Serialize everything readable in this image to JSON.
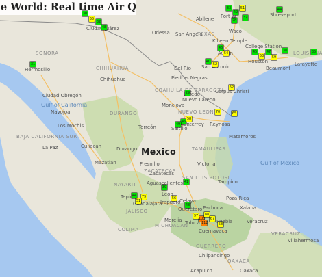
{
  "title": "e World: Real time Air Quality map",
  "country_label": "Mexico",
  "water_labels": [
    "Gulf of California",
    "Gulf of Mexico"
  ],
  "regions": [
    {
      "id": "sonora",
      "text": "SONORA"
    },
    {
      "id": "chihuahua",
      "text": "CHIHUAHUA"
    },
    {
      "id": "coahuila",
      "text": "COAHUILA DE ZARAGOZA"
    },
    {
      "id": "texas",
      "text": "TEXAS"
    },
    {
      "id": "nuevo-leon",
      "text": "NUEVO LEON"
    },
    {
      "id": "tamaulipas",
      "text": "TAMAULIPAS"
    },
    {
      "id": "durango",
      "text": "DURANGO"
    },
    {
      "id": "zacatecas",
      "text": "ZACATECAS"
    },
    {
      "id": "san-luis",
      "text": "SAN LUIS POTOSI"
    },
    {
      "id": "nayarit",
      "text": "NAYARIT"
    },
    {
      "id": "jalisco",
      "text": "JALISCO"
    },
    {
      "id": "michoacan",
      "text": "MICHOACAN"
    },
    {
      "id": "guerrero",
      "text": "GUERRERO"
    },
    {
      "id": "oaxaca",
      "text": "OAXACA"
    },
    {
      "id": "veracruz",
      "text": "VERACRUZ"
    },
    {
      "id": "baja",
      "text": "BAJA CALIFORNIA SUR"
    },
    {
      "id": "louisiana",
      "text": "LOUISIANA"
    },
    {
      "id": "colima",
      "text": "COLIMA"
    }
  ],
  "cities": [
    {
      "id": "ciudad-juarez",
      "text": "Ciudad Juárez"
    },
    {
      "id": "hermosillo",
      "text": "Hermosillo"
    },
    {
      "id": "chihuahua-city",
      "text": "Chihuahua"
    },
    {
      "id": "monterrey",
      "text": "Monterrey"
    },
    {
      "id": "saltillo",
      "text": "Saltillo"
    },
    {
      "id": "torreon",
      "text": "Torreón"
    },
    {
      "id": "durango-city",
      "text": "Durango"
    },
    {
      "id": "culiacan",
      "text": "Culiacán"
    },
    {
      "id": "mazatlan",
      "text": "Mazatlán"
    },
    {
      "id": "la-paz",
      "text": "La Paz"
    },
    {
      "id": "los-mochis",
      "text": "Los Mochis"
    },
    {
      "id": "aguascalientes",
      "text": "Aguascalientes"
    },
    {
      "id": "guadalajara",
      "text": "Guadalajara"
    },
    {
      "id": "tepic",
      "text": "Tepic"
    },
    {
      "id": "leon",
      "text": "León"
    },
    {
      "id": "queretaro",
      "text": "Querétaro"
    },
    {
      "id": "morelia",
      "text": "Morelia"
    },
    {
      "id": "puebla",
      "text": "Puebla"
    },
    {
      "id": "toluca",
      "text": "Toluca"
    },
    {
      "id": "acapulco",
      "text": "Acapulco"
    },
    {
      "id": "veracruz-city",
      "text": "Veracruz"
    },
    {
      "id": "tampico",
      "text": "Tampico"
    },
    {
      "id": "victoria",
      "text": "Victoria"
    },
    {
      "id": "matamoros",
      "text": "Matamoros"
    },
    {
      "id": "reynosa",
      "text": "Reynosa"
    },
    {
      "id": "nuevo-laredo",
      "text": "Nuevo Laredo"
    },
    {
      "id": "laredo",
      "text": "Laredo"
    },
    {
      "id": "corpus",
      "text": "Corpus Christi"
    },
    {
      "id": "san-antonio",
      "text": "San Antonio"
    },
    {
      "id": "austin",
      "text": "Austin"
    },
    {
      "id": "houston",
      "text": "Houston"
    },
    {
      "id": "san-angelo",
      "text": "San Angelo"
    },
    {
      "id": "odessa",
      "text": "Odessa"
    },
    {
      "id": "abilene",
      "text": "Abilene"
    },
    {
      "id": "waco",
      "text": "Waco"
    },
    {
      "id": "fort-worth",
      "text": "Fort W"
    },
    {
      "id": "killeen",
      "text": "Killeen"
    },
    {
      "id": "temple",
      "text": "Temple"
    },
    {
      "id": "college-station",
      "text": "College Station"
    },
    {
      "id": "del-rio",
      "text": "Del Rio"
    },
    {
      "id": "piedras-negras",
      "text": "Piedras Negras"
    },
    {
      "id": "monclova",
      "text": "Monclova"
    },
    {
      "id": "oaxaca-city",
      "text": "Oaxaca"
    },
    {
      "id": "chilpancingo",
      "text": "Chilpancingo"
    },
    {
      "id": "shreveport",
      "text": "Shreveport"
    },
    {
      "id": "lafayette",
      "text": "Lafayette"
    },
    {
      "id": "beaumont",
      "text": "Beaumont"
    },
    {
      "id": "navojoa",
      "text": "Navojoa"
    },
    {
      "id": "ciudad-obregon",
      "text": "Ciudad Obregón"
    },
    {
      "id": "fresnillo",
      "text": "Fresnillo"
    },
    {
      "id": "zacatecas-city",
      "text": "Zacatecas"
    },
    {
      "id": "celaya",
      "text": "Celaya"
    },
    {
      "id": "irapuato",
      "text": "Irapuato"
    },
    {
      "id": "pachuca",
      "text": "Pachuca"
    },
    {
      "id": "xalapa",
      "text": "Xalapa"
    },
    {
      "id": "poza-rica",
      "text": "Poza Rica"
    },
    {
      "id": "cuernavaca",
      "text": "Cuernavaca"
    },
    {
      "id": "villahermosa",
      "text": "Villahermosa"
    }
  ],
  "markers": [
    {
      "id": "m-juarez",
      "value": "32",
      "color": "#00e400"
    },
    {
      "id": "m-juarez-2",
      "value": "48",
      "color": "#00e400"
    },
    {
      "id": "m-juarez-3",
      "value": "55",
      "color": "#ffff00"
    },
    {
      "id": "m-elpaso",
      "value": "30",
      "color": "#00e400"
    },
    {
      "id": "m-dfw-1",
      "value": "33",
      "color": "#00e400"
    },
    {
      "id": "m-dfw-2",
      "value": "42",
      "color": "#00e400"
    },
    {
      "id": "m-dfw-3",
      "value": "51",
      "color": "#ffff00"
    },
    {
      "id": "m-dfw-4",
      "value": "28",
      "color": "#00e400"
    },
    {
      "id": "m-dfw-5",
      "value": "37",
      "color": "#00e400"
    },
    {
      "id": "m-shreveport",
      "value": "44",
      "color": "#00e400"
    },
    {
      "id": "m-austin-1",
      "value": "46",
      "color": "#00e400"
    },
    {
      "id": "m-austin-2",
      "value": "54",
      "color": "#ffff00"
    },
    {
      "id": "m-sa-1",
      "value": "40",
      "color": "#00e400"
    },
    {
      "id": "m-sa-2",
      "value": "52",
      "color": "#ffff00"
    },
    {
      "id": "m-houston-1",
      "value": "53",
      "color": "#ffff00"
    },
    {
      "id": "m-houston-2",
      "value": "47",
      "color": "#00e400"
    },
    {
      "id": "m-houston-3",
      "value": "59",
      "color": "#ffff00"
    },
    {
      "id": "m-houston-4",
      "value": "45",
      "color": "#00e400"
    },
    {
      "id": "m-beaumont",
      "value": "38",
      "color": "#00e400"
    },
    {
      "id": "m-lafayette",
      "value": "35",
      "color": "#00e400"
    },
    {
      "id": "m-corpus",
      "value": "52",
      "color": "#ffff00"
    },
    {
      "id": "m-laredo",
      "value": "29",
      "color": "#00e400"
    },
    {
      "id": "m-monterrey-1",
      "value": "46",
      "color": "#00e400"
    },
    {
      "id": "m-monterrey-2",
      "value": "58",
      "color": "#ffff00"
    },
    {
      "id": "m-monterrey-3",
      "value": "49",
      "color": "#00e400"
    },
    {
      "id": "m-reynosa",
      "value": "70",
      "color": "#ffff00"
    },
    {
      "id": "m-matamoros",
      "value": "65",
      "color": "#ffff00"
    },
    {
      "id": "m-gdl-1",
      "value": "79",
      "color": "#ffff00"
    },
    {
      "id": "m-gdl-2",
      "value": "51",
      "color": "#ffff00"
    },
    {
      "id": "m-gdl-3",
      "value": "44",
      "color": "#00e400"
    },
    {
      "id": "m-leon",
      "value": "56",
      "color": "#ffff00"
    },
    {
      "id": "m-slp",
      "value": "41",
      "color": "#00e400"
    },
    {
      "id": "m-ags",
      "value": "39",
      "color": "#00e400"
    },
    {
      "id": "m-qro",
      "value": "48",
      "color": "#00e400"
    },
    {
      "id": "m-cdmx-1",
      "value": "103",
      "color": "#ff7e00"
    },
    {
      "id": "m-cdmx-2",
      "value": "88",
      "color": "#ffff00"
    },
    {
      "id": "m-cdmx-3",
      "value": "97",
      "color": "#ffff00"
    },
    {
      "id": "m-cdmx-4",
      "value": "112",
      "color": "#ff7e00"
    },
    {
      "id": "m-cdmx-5",
      "value": "67",
      "color": "#ffff00"
    },
    {
      "id": "m-puebla",
      "value": "58",
      "color": "#ffff00"
    },
    {
      "id": "m-hermosillo",
      "value": "31",
      "color": "#00e400"
    }
  ],
  "colors": {
    "sea": "#a6c8f0",
    "land": "#e9e6db",
    "green_land": "#c8dba9",
    "dark_green": "#aacd8f",
    "road": "#f4c065",
    "border": "#8a8a8a",
    "aqi_good": "#00e400",
    "aqi_moderate": "#ffff00",
    "aqi_unhealthy_sensitive": "#ff7e00"
  }
}
